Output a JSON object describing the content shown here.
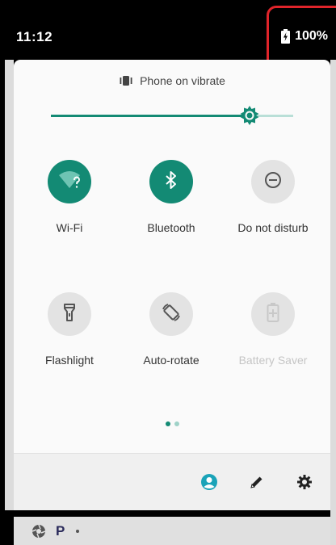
{
  "status_bar": {
    "time": "11:12",
    "battery_percent": "100%",
    "battery_icon": "battery-charging-icon"
  },
  "sound": {
    "mode_label": "Phone on vibrate",
    "icon": "vibrate-icon"
  },
  "brightness": {
    "level": 0.82,
    "accent_color": "#138a74"
  },
  "tiles": [
    {
      "label": "Wi-Fi",
      "icon": "wifi-question-icon",
      "state": "on"
    },
    {
      "label": "Bluetooth",
      "icon": "bluetooth-icon",
      "state": "on"
    },
    {
      "label": "Do not disturb",
      "icon": "do-not-disturb-icon",
      "state": "off"
    },
    {
      "label": "Flashlight",
      "icon": "flashlight-icon",
      "state": "off"
    },
    {
      "label": "Auto-rotate",
      "icon": "auto-rotate-icon",
      "state": "off"
    },
    {
      "label": "Battery Saver",
      "icon": "battery-saver-icon",
      "state": "disabled"
    }
  ],
  "pager": {
    "current_page": 1,
    "total_pages": 2
  },
  "footer": {
    "user_icon": "user-account-icon",
    "edit_icon": "edit-pencil-icon",
    "settings_icon": "settings-gear-icon"
  },
  "notification_peek": {
    "app_letter": "P",
    "icons": [
      "aperture-icon",
      "parking-p-icon",
      "dot-icon"
    ]
  }
}
